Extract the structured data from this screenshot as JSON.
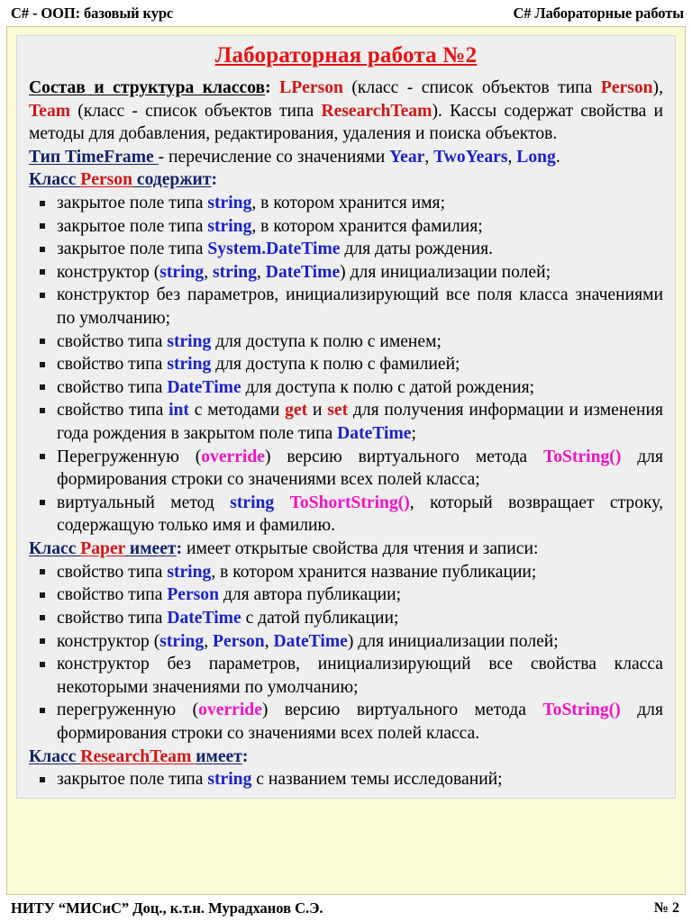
{
  "header": {
    "left": "C# - ООП:  базовый курс",
    "right": "C#  Лабораторные работы"
  },
  "slide": {
    "title": "Лабораторная работа №2"
  },
  "colors": {
    "frame_background": "#fbfad7",
    "panel_background": "#efefef",
    "title_red": "#e81313",
    "keyword_red": "#d21616",
    "keyword_blue": "#1a22cc",
    "keyword_magenta": "#f312c8",
    "heading_navy": "#12236b"
  },
  "content": {
    "intro": {
      "label": "Состав и структура классов",
      "colon": ":",
      "t1": " ",
      "lperson": "LPerson",
      "t2": " (класс - список объектов типа ",
      "person": "Person",
      "t3": "), ",
      "team": "Team",
      "t4": " (класс - список объектов типа ",
      "researchteam": "ResearchTeam",
      "t5": "). Кассы содержат свойства и методы для добавления, редактирования, удаления и поиска объектов."
    },
    "timeframe": {
      "label": "Тип TimeFrame ",
      "t1": "- перечисление со значениями ",
      "year": "Year",
      "t2": ", ",
      "twoyears": "TwoYears",
      "t3": ", ",
      "long": "Long",
      "t4": "."
    },
    "person_heading": {
      "klass": "Класс ",
      "name": "Person",
      "tail": " содержит",
      "colon": ":"
    },
    "person_items": [
      {
        "parts": [
          {
            "text": "закрытое поле типа ",
            "style": "plain"
          },
          {
            "text": "string",
            "style": "blue"
          },
          {
            "text": ", в котором хранится имя;",
            "style": "plain"
          }
        ]
      },
      {
        "parts": [
          {
            "text": "закрытое поле типа ",
            "style": "plain"
          },
          {
            "text": "string",
            "style": "blue"
          },
          {
            "text": ", в котором хранится фамилия;",
            "style": "plain"
          }
        ]
      },
      {
        "parts": [
          {
            "text": "закрытое поле типа ",
            "style": "plain"
          },
          {
            "text": "System.DateTime",
            "style": "blue"
          },
          {
            "text": " для даты рождения.",
            "style": "plain"
          }
        ]
      },
      {
        "parts": [
          {
            "text": "конструктор (",
            "style": "plain"
          },
          {
            "text": "string",
            "style": "blue"
          },
          {
            "text": ", ",
            "style": "plain"
          },
          {
            "text": "string",
            "style": "blue"
          },
          {
            "text": ", ",
            "style": "plain"
          },
          {
            "text": "DateTime",
            "style": "blue"
          },
          {
            "text": ") для инициализации полей;",
            "style": "plain"
          }
        ]
      },
      {
        "parts": [
          {
            "text": "конструктор без параметров, инициализирующий все поля класса значениями по умолчанию;",
            "style": "plain"
          }
        ]
      },
      {
        "parts": [
          {
            "text": "свойство типа ",
            "style": "plain"
          },
          {
            "text": "string",
            "style": "blue"
          },
          {
            "text": " для доступа к полю с именем;",
            "style": "plain"
          }
        ]
      },
      {
        "parts": [
          {
            "text": "свойство типа ",
            "style": "plain"
          },
          {
            "text": "string",
            "style": "blue"
          },
          {
            "text": " для доступа к полю с фамилией;",
            "style": "plain"
          }
        ]
      },
      {
        "parts": [
          {
            "text": "свойство типа ",
            "style": "plain"
          },
          {
            "text": "DateTime",
            "style": "blue"
          },
          {
            "text": " для доступа к полю с датой рождения;",
            "style": "plain"
          }
        ]
      },
      {
        "parts": [
          {
            "text": "свойство типа ",
            "style": "plain"
          },
          {
            "text": "int",
            "style": "blue"
          },
          {
            "text": " с методами ",
            "style": "plain"
          },
          {
            "text": "get",
            "style": "red"
          },
          {
            "text": " и ",
            "style": "plain"
          },
          {
            "text": "set",
            "style": "red"
          },
          {
            "text": " для получения информации и изменения года рождения в закрытом поле типа ",
            "style": "plain"
          },
          {
            "text": "DateTime",
            "style": "blue"
          },
          {
            "text": ";",
            "style": "plain"
          }
        ]
      },
      {
        "parts": [
          {
            "text": "Перегруженную (",
            "style": "plain"
          },
          {
            "text": "override",
            "style": "magenta"
          },
          {
            "text": ") версию виртуального метода ",
            "style": "plain"
          },
          {
            "text": "ToString()",
            "style": "magenta"
          },
          {
            "text": " для формирования строки со значениями всех полей класса;",
            "style": "plain"
          }
        ]
      },
      {
        "parts": [
          {
            "text": "виртуальный метод ",
            "style": "plain"
          },
          {
            "text": "string",
            "style": "blue"
          },
          {
            "text": " ",
            "style": "plain"
          },
          {
            "text": "ToShortString()",
            "style": "magenta"
          },
          {
            "text": ", который возвращает строку, содержащую только имя и фамилию.",
            "style": "plain"
          }
        ]
      }
    ],
    "paper_heading": {
      "klass": "Класс ",
      "name": "Paper",
      "tail": " имеет",
      "colon": ":",
      "after": "  имеет открытые свойства для чтения и записи:"
    },
    "paper_items": [
      {
        "parts": [
          {
            "text": "свойство типа ",
            "style": "plain"
          },
          {
            "text": "string",
            "style": "blue"
          },
          {
            "text": ", в котором хранится название публикации;",
            "style": "plain"
          }
        ]
      },
      {
        "parts": [
          {
            "text": "свойство типа ",
            "style": "plain"
          },
          {
            "text": "Person",
            "style": "blue"
          },
          {
            "text": " для автора публикации;",
            "style": "plain"
          }
        ]
      },
      {
        "parts": [
          {
            "text": "свойство типа ",
            "style": "plain"
          },
          {
            "text": "DateTime",
            "style": "blue"
          },
          {
            "text": " с датой публикации;",
            "style": "plain"
          }
        ]
      },
      {
        "parts": [
          {
            "text": "конструктор (",
            "style": "plain"
          },
          {
            "text": "string",
            "style": "blue"
          },
          {
            "text": ", ",
            "style": "plain"
          },
          {
            "text": "Person",
            "style": "blue"
          },
          {
            "text": ", ",
            "style": "plain"
          },
          {
            "text": "DateTime",
            "style": "blue"
          },
          {
            "text": ") для инициализации полей;",
            "style": "plain"
          }
        ]
      },
      {
        "parts": [
          {
            "text": "конструктор без параметров, инициализирующий все свойства класса некоторыми значениями по умолчанию;",
            "style": "plain"
          }
        ]
      },
      {
        "parts": [
          {
            "text": "перегруженную (",
            "style": "plain"
          },
          {
            "text": "override",
            "style": "magenta"
          },
          {
            "text": ") версию виртуального метода ",
            "style": "plain"
          },
          {
            "text": "ToString()",
            "style": "magenta"
          },
          {
            "text": " для формирования строки со значениями всех полей класса.",
            "style": "plain"
          }
        ]
      }
    ],
    "researchteam_heading": {
      "klass": "Класс ",
      "name": "ResearchTeam ",
      "tail": " имеет",
      "colon": ":"
    },
    "researchteam_items": [
      {
        "parts": [
          {
            "text": "закрытое поле типа ",
            "style": "plain"
          },
          {
            "text": "string",
            "style": "blue"
          },
          {
            "text": " с названием темы исследований;",
            "style": "plain"
          }
        ]
      }
    ]
  },
  "footer": {
    "left": "НИТУ “МИСиС”  Доц., к.т.н. Мурадханов С.Э.",
    "page": "№ 2"
  }
}
